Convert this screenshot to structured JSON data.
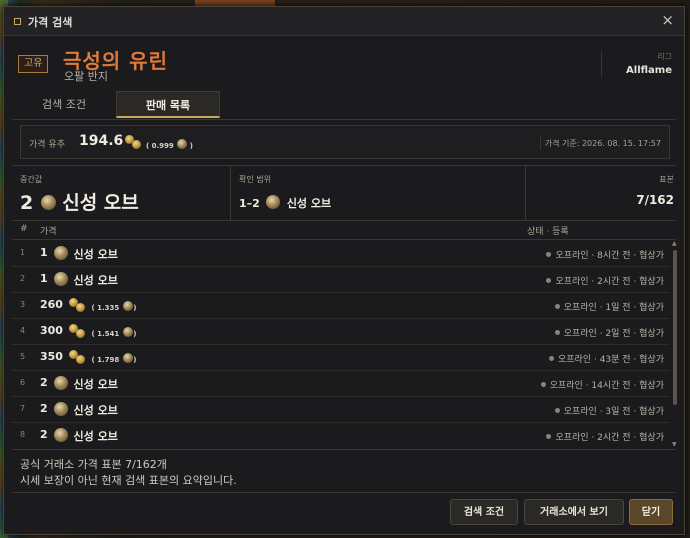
{
  "dialog": {
    "title": "가격 검색",
    "close": "×"
  },
  "item": {
    "badge": "고유",
    "name": "극성의 유린",
    "subtitle": "오팔 반지",
    "league_label": "리그",
    "league_value": "Allflame"
  },
  "tabs": [
    {
      "label": "검색 조건",
      "active": false
    },
    {
      "label": "판매 목록",
      "active": true
    }
  ],
  "summary": {
    "label": "가격 유추",
    "value": "194.6",
    "ratio": "( 0.999",
    "ratio_close": ")",
    "date": "가격 기준: 2026. 08. 15. 17:57"
  },
  "stats": {
    "median_label": "중간값",
    "median_qty": "2",
    "median_currency": "신성 오브",
    "range_label": "확인 범위",
    "range_value": "1–2",
    "range_currency": "신성 오브",
    "sample_label": "표본",
    "sample_value": "7/162"
  },
  "table": {
    "col_num": "#",
    "col_price": "가격",
    "col_status": "상태 · 등록",
    "rows": [
      {
        "n": "1",
        "qty": "1",
        "currency_type": "divine",
        "currency": "신성 오브",
        "ratio": "",
        "status": "오프라인 · 8시간 전 · 협상가"
      },
      {
        "n": "2",
        "qty": "1",
        "currency_type": "divine",
        "currency": "신성 오브",
        "ratio": "",
        "status": "오프라인 · 2시간 전 · 협상가"
      },
      {
        "n": "3",
        "qty": "260",
        "currency_type": "chaos",
        "currency": "",
        "ratio": "( 1.335",
        "status": "오프라인 · 1일 전 · 협상가"
      },
      {
        "n": "4",
        "qty": "300",
        "currency_type": "chaos",
        "currency": "",
        "ratio": "( 1.541",
        "status": "오프라인 · 2일 전 · 협상가"
      },
      {
        "n": "5",
        "qty": "350",
        "currency_type": "chaos",
        "currency": "",
        "ratio": "( 1.798",
        "status": "오프라인 · 43분 전 · 협상가"
      },
      {
        "n": "6",
        "qty": "2",
        "currency_type": "divine",
        "currency": "신성 오브",
        "ratio": "",
        "status": "오프라인 · 14시간 전 · 협상가"
      },
      {
        "n": "7",
        "qty": "2",
        "currency_type": "divine",
        "currency": "신성 오브",
        "ratio": "",
        "status": "오프라인 · 3일 전 · 협상가"
      },
      {
        "n": "8",
        "qty": "2",
        "currency_type": "divine",
        "currency": "신성 오브",
        "ratio": "",
        "status": "오프라인 · 2시간 전 · 협상가"
      }
    ]
  },
  "footer": {
    "note1": "공식 거래소 가격 표본 7/162개",
    "note2": "시세 보장이 아닌 현재 검색 표본의 요약입니다.",
    "btn_search": "검색 조건",
    "btn_trade": "거래소에서 보기",
    "btn_close": "닫기"
  },
  "colors": {
    "accent": "#c8a860",
    "unique_name": "#e07a3a",
    "panel": "#1b1b1d"
  }
}
